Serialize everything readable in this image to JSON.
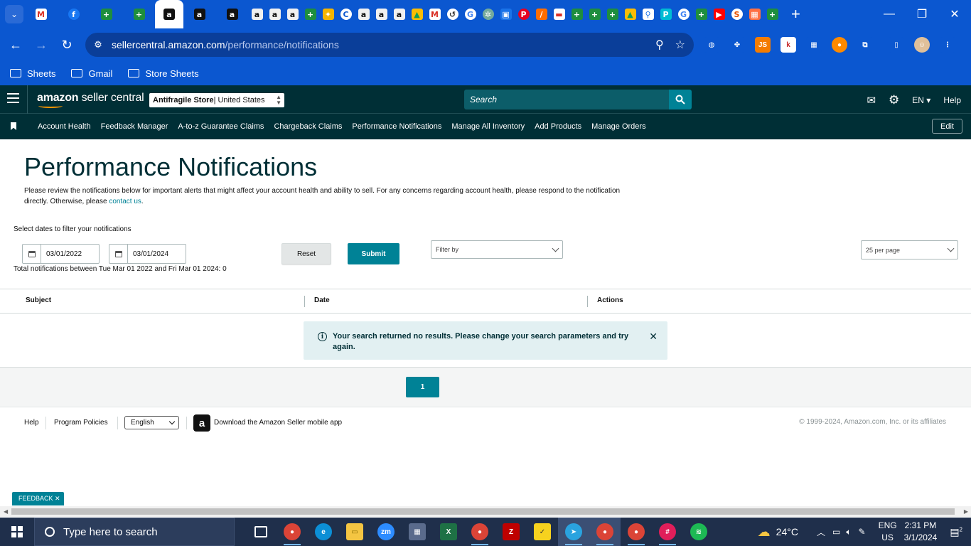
{
  "browser": {
    "url_host": "sellercentral.amazon.com",
    "url_path": "/performance/notifications",
    "new_tab_glyph": "+",
    "bookmarks": [
      "Sheets",
      "Gmail",
      "Store Sheets"
    ]
  },
  "header": {
    "logo_bold": "amazon",
    "logo_text": " seller central",
    "store_name": "Antifragile Store",
    "store_region": " | United States",
    "search_placeholder": "Search",
    "language": "EN",
    "help": "Help"
  },
  "nav": {
    "links": [
      "Account Health",
      "Feedback Manager",
      "A-to-z Guarantee Claims",
      "Chargeback Claims",
      "Performance Notifications",
      "Manage All Inventory",
      "Add Products",
      "Manage Orders"
    ],
    "edit_label": "Edit"
  },
  "main": {
    "title": "Performance Notifications",
    "intro_text": "Please review the notifications below for important alerts that might affect your account health and ability to sell. For any concerns regarding account health, please respond to the notification directly. Otherwise, please ",
    "intro_link": "contact us",
    "intro_end": ".",
    "filter_label": "Select dates to filter your notifications",
    "start_date": "03/01/2022",
    "end_date": "03/01/2024",
    "reset_label": "Reset",
    "submit_label": "Submit",
    "filter_by": "Filter by",
    "per_page": "25 per page",
    "total_text": "Total notifications between Tue Mar 01 2022 and Fri Mar 01 2024: 0"
  },
  "table": {
    "columns": [
      "Subject",
      "Date",
      "Actions"
    ],
    "empty_message": "Your search returned no results. Please change your search parameters and try again.",
    "info_glyph": "i",
    "close_glyph": "✕"
  },
  "pagination": {
    "current_page": "1"
  },
  "footer": {
    "help": "Help",
    "program_policies": "Program Policies",
    "language": "English",
    "app_link": "Download the Amazon Seller mobile app",
    "copyright": "© 1999-2024, Amazon.com, Inc. or its affiliates"
  },
  "feedback_label": "FEEDBACK ✕",
  "taskbar": {
    "search_placeholder": "Type here to search",
    "temperature": "24°C",
    "input_lang": "ENG",
    "input_region": "US",
    "time": "2:31 PM",
    "date": "3/1/2024",
    "notifications_count": "2"
  },
  "colors": {
    "chrome_blue": "#0b57d0",
    "sc_header": "#002f36",
    "accent_teal": "#008296",
    "alert_bg": "#e2f0f2"
  }
}
